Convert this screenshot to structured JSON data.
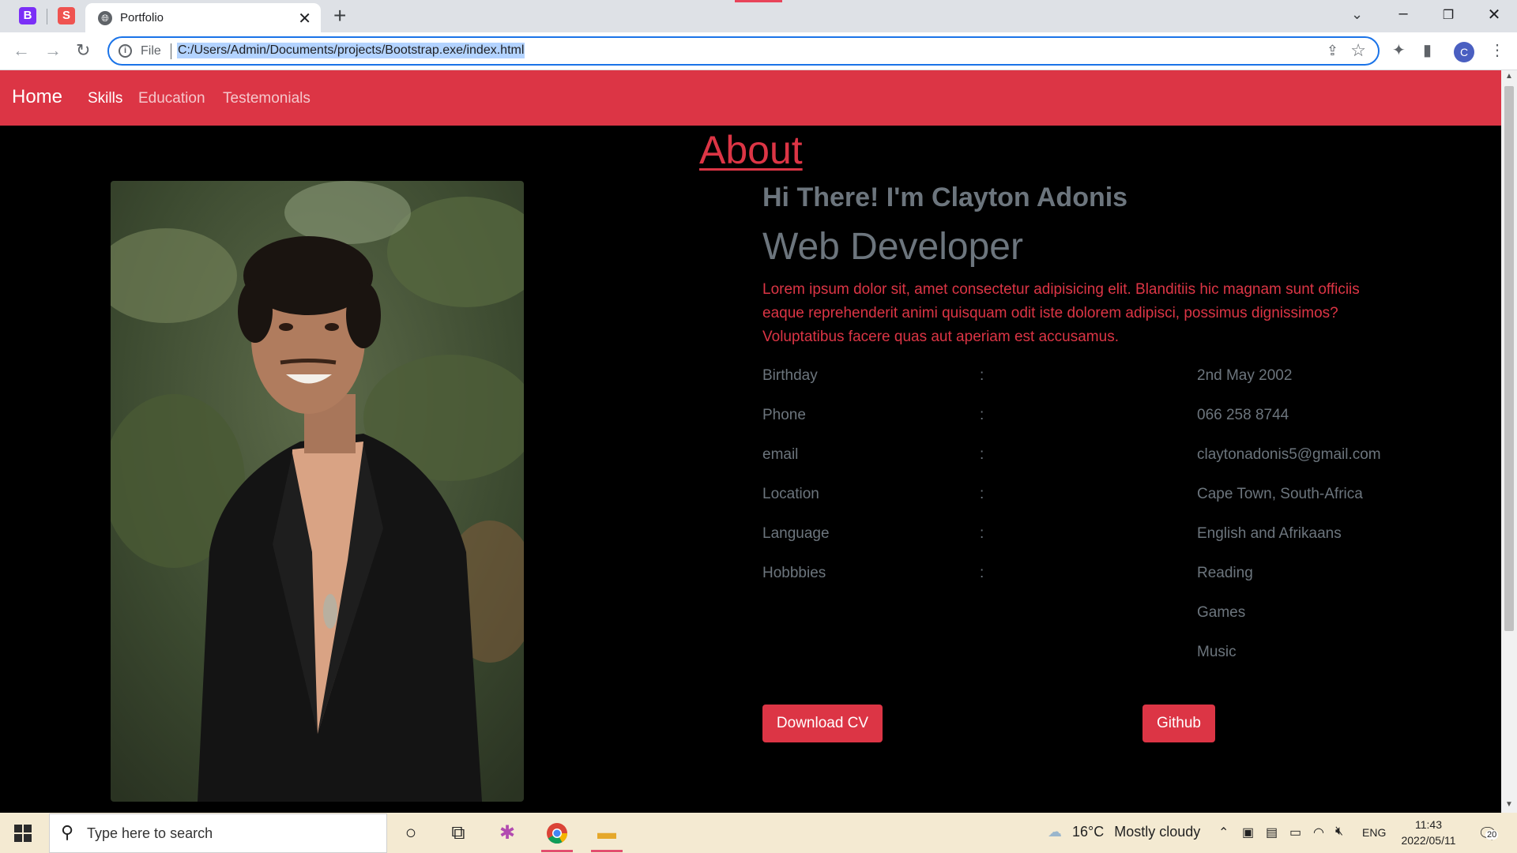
{
  "browser": {
    "tab_title": "Portfolio",
    "pinned_tabs": [
      "B",
      "S"
    ],
    "address_prefix": "File",
    "url": "C:/Users/Admin/Documents/projects/Bootstrap.exe/index.html",
    "profile_initial": "C"
  },
  "navbar": {
    "brand": "Home",
    "links": [
      "Skills",
      "Education",
      "Testemonials"
    ]
  },
  "about": {
    "heading": "About",
    "greeting": "Hi There! I'm Clayton Adonis",
    "role": "Web Developer",
    "description": "Lorem ipsum dolor sit, amet consectetur adipisicing elit. Blanditiis hic magnam sunt officiis eaque reprehenderit animi quisquam odit iste dolorem adipisci, possimus dignissimos? Voluptatibus facere quas aut aperiam est accusamus.",
    "separator": ":",
    "details": [
      {
        "label": "Birthday",
        "value": "2nd May 2002"
      },
      {
        "label": "Phone",
        "value": "066 258 8744"
      },
      {
        "label": "email",
        "value": "claytonadonis5@gmail.com"
      },
      {
        "label": "Location",
        "value": "Cape Town, South-Africa"
      },
      {
        "label": "Language",
        "value": "English and Afrikaans"
      },
      {
        "label": "Hobbbies",
        "value": "Reading"
      }
    ],
    "extra_hobbies": [
      "Games",
      "Music"
    ],
    "buttons": {
      "download": "Download CV",
      "github": "Github"
    }
  },
  "taskbar": {
    "search_placeholder": "Type here to search",
    "weather_temp": "16°C",
    "weather_text": "Mostly cloudy",
    "language": "ENG",
    "time": "11:43",
    "date": "2022/05/11",
    "notification_count": "20"
  },
  "colors": {
    "accent": "#dc3545",
    "muted": "#6c757d",
    "page_bg": "#000000"
  }
}
